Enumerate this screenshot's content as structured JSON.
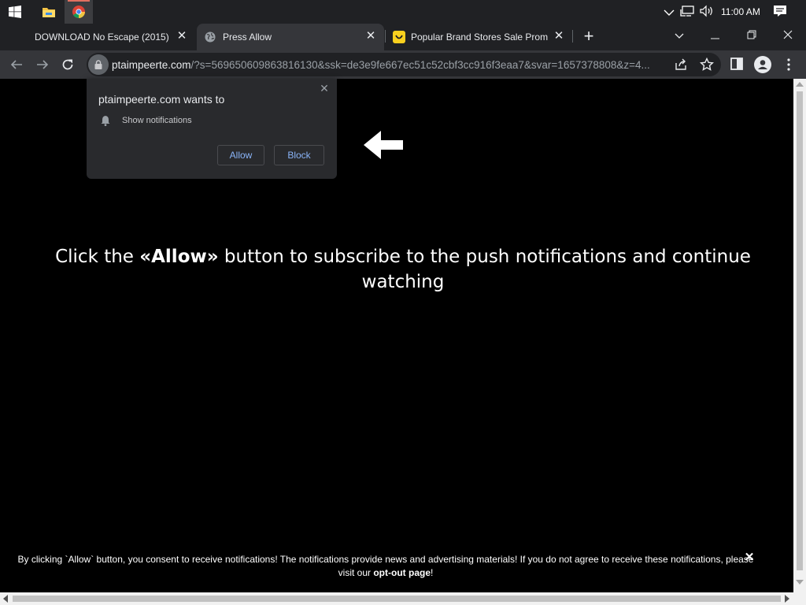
{
  "taskbar": {
    "clock": "11:00 AM"
  },
  "tabs": [
    {
      "title": "DOWNLOAD No Escape (2015) | |"
    },
    {
      "title": "Press Allow"
    },
    {
      "title": "Popular Brand Stores Sale Promo"
    }
  ],
  "toolbar": {
    "url_host": "ptaimpeerte.com",
    "url_rest": "/?s=569650609863816130&ssk=de3e9fe667ec51c52cbf3cc916f3eaa7&svar=1657378808&z=4..."
  },
  "permission_prompt": {
    "title": "ptaimpeerte.com wants to",
    "item": "Show notifications",
    "allow_label": "Allow",
    "block_label": "Block"
  },
  "page": {
    "headline_part1": "Click the ",
    "headline_bold": "«Allow»",
    "headline_part2": " button to subscribe to the push notifications and continue watching",
    "footer_text": "By clicking `Allow` button, you consent to receive notifications! The notifications provide news and advertising materials! If you do not agree to receive these notifications, please visit our ",
    "footer_link": "opt-out page",
    "footer_end": "!"
  },
  "colors": {
    "page_bg": "#000000",
    "accent_blue": "#8ab4f8"
  },
  "icons": [
    "windows-start-icon",
    "file-explorer-icon",
    "chrome-icon",
    "chevron-up-icon",
    "network-icon",
    "volume-icon",
    "action-center-icon",
    "globe-icon",
    "emoji-icon",
    "new-tab-icon",
    "back-icon",
    "forward-icon",
    "reload-icon",
    "lock-icon",
    "share-icon",
    "star-icon",
    "side-panel-icon",
    "profile-icon",
    "menu-icon",
    "bell-icon",
    "arrow-left-icon"
  ]
}
